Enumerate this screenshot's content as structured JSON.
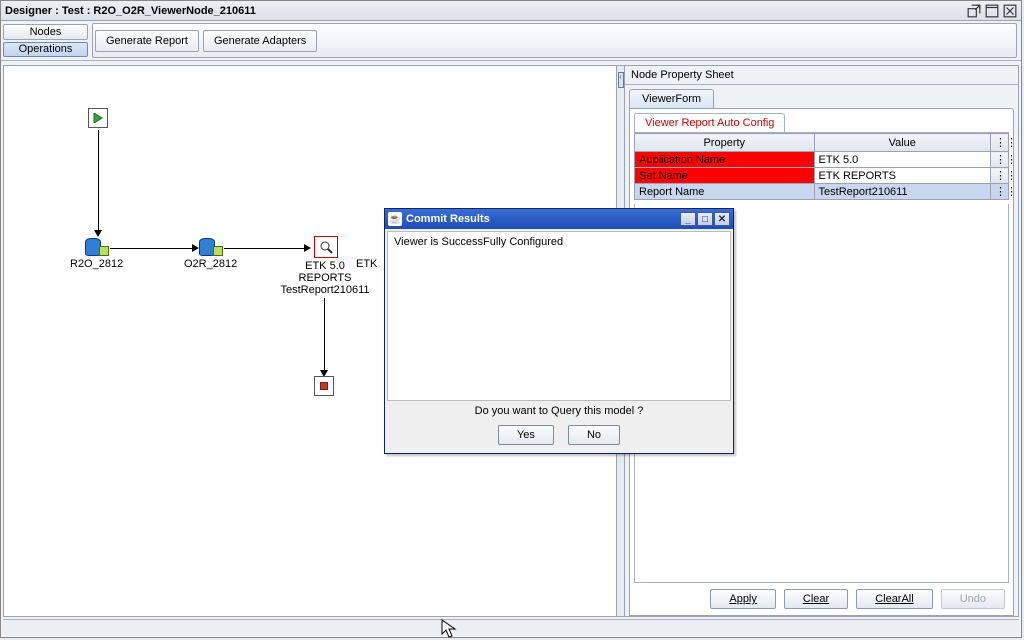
{
  "window": {
    "title": "Designer : Test : R2O_O2R_ViewerNode_210611",
    "icons": {
      "detach": "detach-icon",
      "maximize": "maximize-icon",
      "close": "close-icon"
    }
  },
  "side_tabs": {
    "nodes": "Nodes",
    "operations": "Operations",
    "active": "operations"
  },
  "toolbar": {
    "generate_report": "Generate Report",
    "generate_adapters": "Generate Adapters"
  },
  "splitter": {
    "label": "‹"
  },
  "canvas_nodes": {
    "start": {
      "label": ""
    },
    "r2o": {
      "label": "R2O_2812"
    },
    "o2r": {
      "label": "O2R_2812"
    },
    "viewer": {
      "line1": "ETK 5.0",
      "line2": "REPORTS",
      "line3": "TestReport210611",
      "right_label": "ETK"
    },
    "end": {
      "label": ""
    }
  },
  "prop_sheet": {
    "title": "Node Property Sheet",
    "tab": "ViewerForm",
    "subtab": "Viewer Report Auto Config",
    "headers": {
      "property": "Property",
      "value": "Value",
      "more": "⋮⋮"
    },
    "rows": [
      {
        "key": "Application Name",
        "value": "ETK 5.0",
        "highlight": true
      },
      {
        "key": "Set Name",
        "value": "ETK REPORTS",
        "highlight": true
      },
      {
        "key": "Report Name",
        "value": "TestReport210611",
        "highlight": false,
        "selected": true
      }
    ],
    "buttons": {
      "apply": "Apply",
      "clear": "Clear",
      "clear_all": "ClearAll",
      "undo": "Undo"
    }
  },
  "dialog": {
    "title": "Commit Results",
    "message": "Viewer is SuccessFully Configured",
    "question": "Do you want to Query this model ?",
    "yes": "Yes",
    "no": "No",
    "win": {
      "min": "_",
      "max": "□",
      "close": "✕"
    }
  }
}
